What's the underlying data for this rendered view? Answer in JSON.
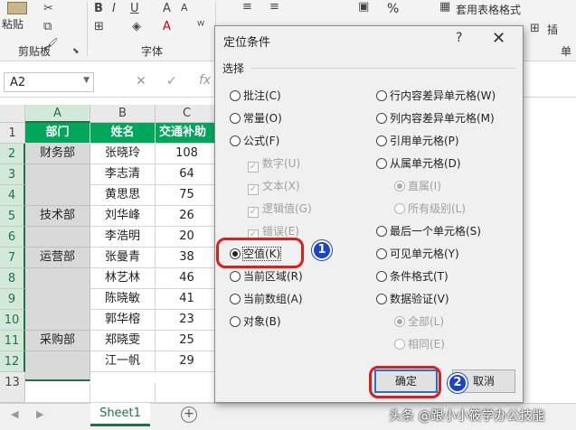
{
  "ribbon": {
    "paste_label": "粘贴",
    "clipboard_label": "剪贴板",
    "font_label": "字体",
    "percent_symbol": "%",
    "table_format_label": "套用表格格式",
    "insert_label": "插",
    "cell_label": "单"
  },
  "formula_bar": {
    "name_box": "A2",
    "fx": "fx",
    "cancel": "✕",
    "enter": "✓"
  },
  "sheet": {
    "columns": [
      "A",
      "B",
      "C"
    ],
    "rows": [
      "1",
      "2",
      "3",
      "4",
      "5",
      "6",
      "7",
      "8",
      "9",
      "10",
      "11",
      "12",
      "13"
    ],
    "headers": [
      "部门",
      "姓名",
      "交通补助"
    ],
    "departments": [
      "财务部",
      "技术部",
      "运营部",
      "采购部"
    ],
    "names": [
      "张晓玲",
      "李志清",
      "黄思思",
      "刘华峰",
      "李浩明",
      "张曼青",
      "林艺林",
      "陈晓敏",
      "郭华榕",
      "郑晓雯",
      "江一帆"
    ],
    "amounts": [
      "108",
      "64",
      "75",
      "26",
      "20",
      "38",
      "46",
      "41",
      "23",
      "25",
      "29"
    ],
    "tab_name": "Sheet1",
    "add_symbol": "+"
  },
  "dialog": {
    "title": "定位条件",
    "help": "?",
    "close": "✕",
    "group": "选择",
    "left_options": [
      {
        "label": "批注(C)"
      },
      {
        "label": "常量(O)"
      },
      {
        "label": "公式(F)"
      },
      {
        "label": "数字(U)"
      },
      {
        "label": "文本(X)"
      },
      {
        "label": "逻辑值(G)"
      },
      {
        "label": "错误(E)"
      },
      {
        "label": "空值(K)"
      },
      {
        "label": "当前区域(R)"
      },
      {
        "label": "当前数组(A)"
      },
      {
        "label": "对象(B)"
      }
    ],
    "right_options": [
      {
        "label": "行内容差异单元格(W)"
      },
      {
        "label": "列内容差异单元格(M)"
      },
      {
        "label": "引用单元格(P)"
      },
      {
        "label": "从属单元格(D)"
      },
      {
        "label": "直属(I)"
      },
      {
        "label": "所有级别(L)"
      },
      {
        "label": "最后一个单元格(S)"
      },
      {
        "label": "可见单元格(Y)"
      },
      {
        "label": "条件格式(T)"
      },
      {
        "label": "数据验证(V)"
      },
      {
        "label": "全部(L)"
      },
      {
        "label": "相同(E)"
      }
    ],
    "ok": "确定",
    "cancel": "取消"
  },
  "annotations": {
    "badge1": "1",
    "badge2": "2"
  },
  "watermark": "头条 @跟小小筱学办公技能",
  "colors": {
    "header_green": "#00a65a",
    "merged_gray": "#d9d9d9",
    "annotation_red": "#e21b1b",
    "badge_blue": "#1a44c8"
  }
}
